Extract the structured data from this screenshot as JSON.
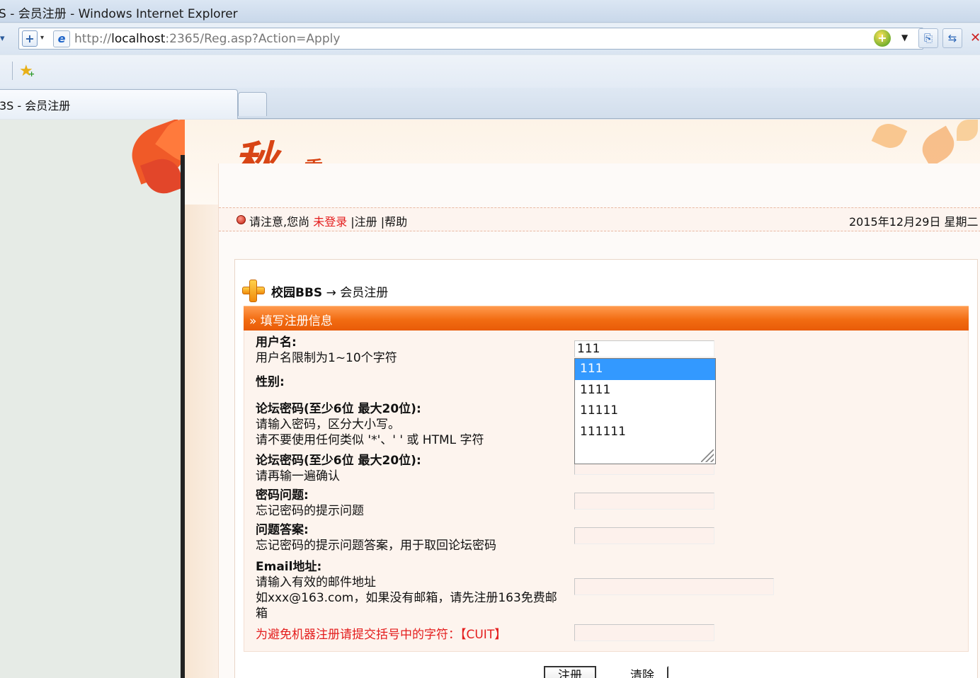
{
  "window": {
    "title": "S - 会员注册 - Windows Internet Explorer"
  },
  "address_bar": {
    "url_prefix": "http://",
    "url_host": "localhost",
    "url_rest": ":2365/Reg.asp?Action=Apply"
  },
  "tabs": {
    "active_label": "3S - 会员注册"
  },
  "notice": {
    "prefix": "请注意,您尚 ",
    "login_status": "未登录",
    "links": [
      " |注册",
      " |帮助"
    ],
    "date": "2015年12月29日 星期二"
  },
  "logo": {
    "big": "秋",
    "small": "季"
  },
  "breadcrumb": {
    "site": "校园BBS",
    "arrow": " → ",
    "page": "会员注册"
  },
  "section_title": "» 填写注册信息",
  "form": {
    "username": {
      "label": "用户名:",
      "hint": "用户名限制为1~10个字符",
      "value": "111"
    },
    "gender": {
      "label": "性别:"
    },
    "password": {
      "label": "论坛密码(至少6位 最大20位):",
      "hint1": "请输入密码，区分大小写。",
      "hint2": "请不要使用任何类似 '*'、' ' 或 HTML 字符"
    },
    "password_confirm": {
      "label": "论坛密码(至少6位 最大20位):",
      "hint": "请再输一遍确认"
    },
    "question": {
      "label": "密码问题:",
      "hint": "忘记密码的提示问题"
    },
    "answer": {
      "label": "问题答案:",
      "hint": "忘记密码的提示问题答案，用于取回论坛密码"
    },
    "email": {
      "label": "Email地址:",
      "hint1": "请输入有效的邮件地址",
      "hint2": "如xxx@163.com，如果没有邮箱，请先注册163免费邮",
      "hint3": "箱"
    },
    "captcha": {
      "label": "为避免机器注册请提交括号中的字符：【CUIT】"
    }
  },
  "autocomplete": [
    "111",
    "1111",
    "11111",
    "111111"
  ],
  "buttons": {
    "submit": "注册",
    "clear": "清除"
  }
}
